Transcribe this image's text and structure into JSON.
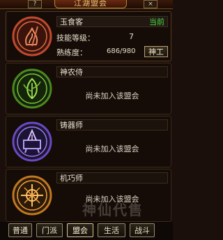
{
  "header": {
    "title": "江湖盟会",
    "left_button": "?",
    "right_button": "×"
  },
  "professions": [
    {
      "name": "玉食客",
      "status": "当前",
      "skill_level_label": "技能等级：",
      "skill_level_value": "7",
      "proficiency_label": "熟练度：",
      "proficiency_value": "686/980",
      "action_button": "神工",
      "icon": "cooking-icon",
      "color": "#d05a3a"
    },
    {
      "name": "神农侍",
      "message": "尚未加入该盟会",
      "icon": "herb-icon",
      "color": "#6ab030"
    },
    {
      "name": "铸器师",
      "message": "尚未加入该盟会",
      "icon": "forge-icon",
      "color": "#8a6ad8"
    },
    {
      "name": "机巧师",
      "message": "尚未加入该盟会",
      "icon": "mechanism-icon",
      "color": "#e09030"
    }
  ],
  "tabs": [
    "普通",
    "门派",
    "盟会",
    "生活",
    "战斗"
  ],
  "watermark": "神仙代售"
}
